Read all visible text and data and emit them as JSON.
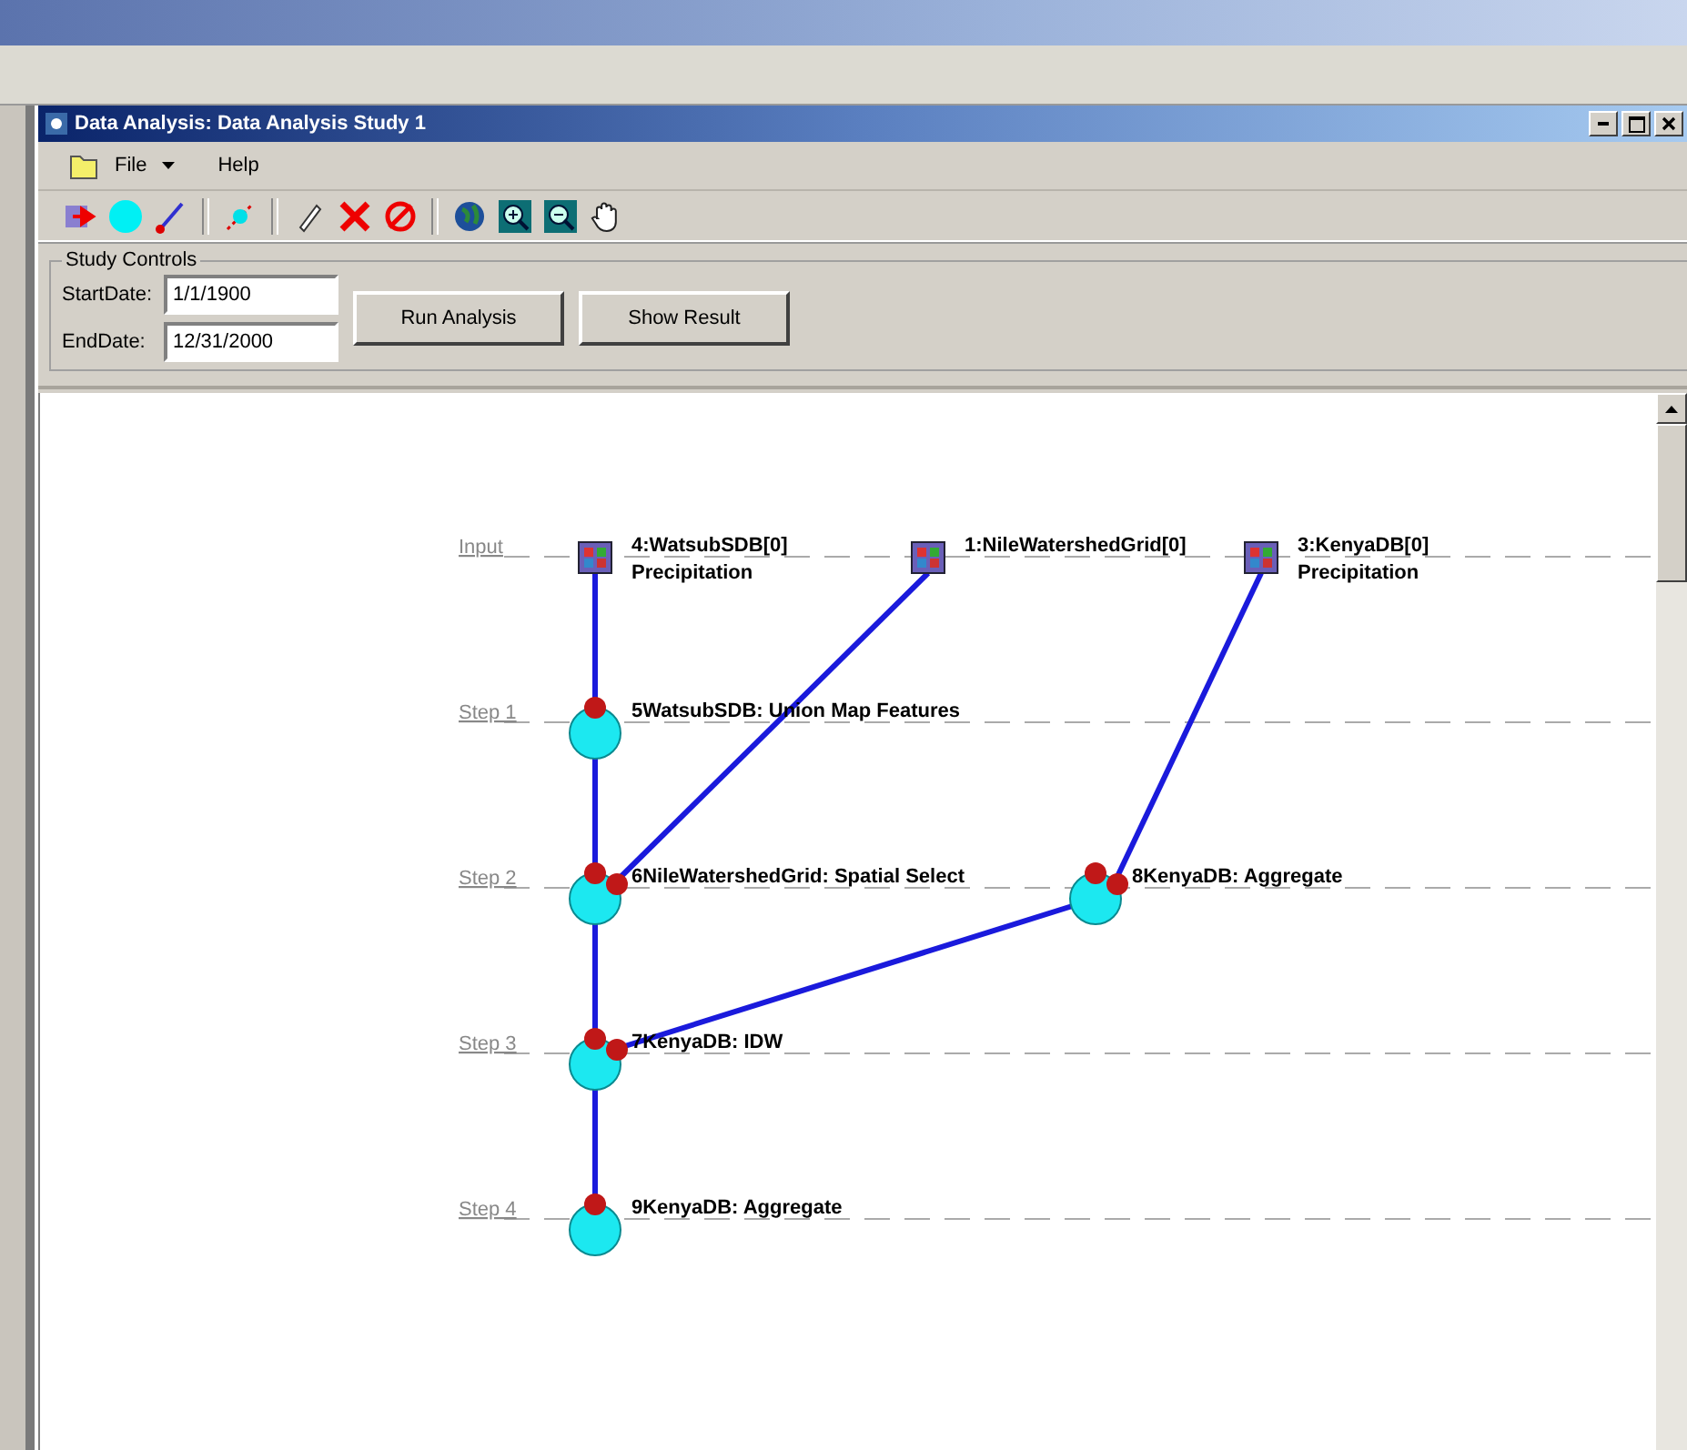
{
  "window": {
    "title": "Data Analysis: Data Analysis Study 1"
  },
  "menu": [
    {
      "label": "File",
      "has_dropdown": true,
      "kind": "file"
    },
    {
      "label": "Help",
      "has_dropdown": false,
      "kind": "plain"
    }
  ],
  "toolbar": [
    {
      "kind": "add-input"
    },
    {
      "kind": "add-step"
    },
    {
      "kind": "add-link"
    },
    {
      "kind": "sep"
    },
    {
      "kind": "connect"
    },
    {
      "kind": "sep"
    },
    {
      "kind": "select"
    },
    {
      "kind": "delete"
    },
    {
      "kind": "clear"
    },
    {
      "kind": "sep"
    },
    {
      "kind": "globe"
    },
    {
      "kind": "zoom-in"
    },
    {
      "kind": "zoom-out"
    },
    {
      "kind": "pan"
    }
  ],
  "study_controls": {
    "title": "Study Controls",
    "start_label": "StartDate:",
    "start_value": "1/1/1900",
    "end_label": "EndDate:",
    "end_value": "12/31/2000",
    "buttons": [
      "Run Analysis",
      "Show Result"
    ]
  },
  "diagram": {
    "rows": [
      {
        "label": "Input",
        "nodes": [
          {
            "kind": "input",
            "lines": [
              "4:WatsubSDB[0]",
              "Precipitation"
            ]
          },
          {
            "kind": "input",
            "lines": [
              "1:NileWatershedGrid[0]"
            ]
          },
          {
            "kind": "input",
            "lines": [
              "3:KenyaDB[0]",
              "Precipitation"
            ]
          }
        ]
      },
      {
        "label": "Step 1",
        "nodes": [
          {
            "kind": "step",
            "lines": [
              "5WatsubSDB: Union Map Features"
            ]
          }
        ]
      },
      {
        "label": "Step 2",
        "nodes": [
          {
            "kind": "step",
            "lines": [
              "6NileWatershedGrid: Spatial Select"
            ]
          },
          {
            "kind": "step",
            "lines": [
              "8KenyaDB: Aggregate"
            ]
          }
        ]
      },
      {
        "label": "Step 3",
        "nodes": [
          {
            "kind": "step",
            "lines": [
              "7KenyaDB: IDW"
            ]
          }
        ]
      },
      {
        "label": "Step 4",
        "nodes": [
          {
            "kind": "step",
            "lines": [
              "9KenyaDB: Aggregate"
            ]
          }
        ]
      }
    ]
  }
}
